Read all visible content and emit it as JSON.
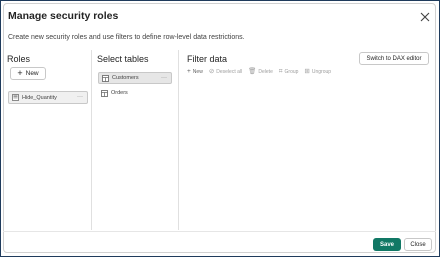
{
  "dialog": {
    "title": "Manage security roles",
    "description": "Create new security roles and use filters to define row-level data restrictions."
  },
  "roles": {
    "heading": "Roles",
    "new_label": "New",
    "items": [
      {
        "label": "Hide_Quantity",
        "icon": "role-icon"
      }
    ]
  },
  "tables": {
    "heading": "Select tables",
    "items": [
      {
        "label": "Customers",
        "icon": "table-icon",
        "selected": true
      },
      {
        "label": "Orders",
        "icon": "table-icon",
        "selected": false
      }
    ]
  },
  "filter": {
    "heading": "Filter data",
    "dax_button": "Switch to DAX editor",
    "toolbar": [
      {
        "label": "New",
        "icon": "plus-icon",
        "enabled": true
      },
      {
        "label": "Deselect all",
        "icon": "deselect-icon",
        "enabled": false
      },
      {
        "label": "Delete",
        "icon": "trash-icon",
        "enabled": false
      },
      {
        "label": "Group",
        "icon": "group-icon",
        "enabled": false
      },
      {
        "label": "Ungroup",
        "icon": "ungroup-icon",
        "enabled": false
      }
    ]
  },
  "footer": {
    "save_label": "Save",
    "close_label": "Close"
  },
  "colors": {
    "accent": "#117865"
  }
}
